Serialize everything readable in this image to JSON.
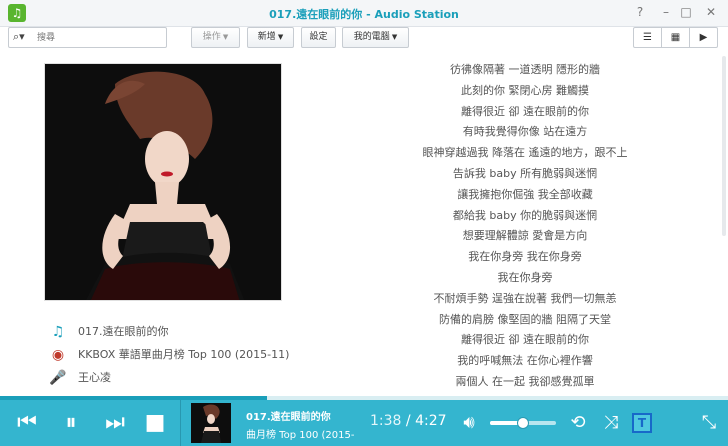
{
  "window": {
    "title_song": "017.遠在眼前的你",
    "title_sep": " - ",
    "title_app": "Audio Station",
    "buttons": {
      "help": "?",
      "minimize": "–",
      "maximize": "□",
      "close": "✕"
    }
  },
  "toolbar": {
    "search_placeholder": "搜尋",
    "action_label": "操作",
    "add_label": "新增",
    "settings_label": "設定",
    "my_computer_label": "我的電腦"
  },
  "song": {
    "title": "017.遠在眼前的你",
    "album": "KKBOX 華語單曲月榜 Top 100 (2015-11)",
    "artist": "王心凌"
  },
  "lyrics": [
    "彷彿像隔著 一道透明 隱形的牆",
    "此刻的你 緊閉心房 難觸摸",
    "離得很近 卻 遠在眼前的你",
    "有時我覺得你像 站在遠方",
    "眼神穿越過我 降落在 遙遠的地方，跟不上",
    "告訴我 baby 所有脆弱與迷惘",
    "讓我擁抱你倔強 我全部收藏",
    "都給我 baby 你的脆弱與迷惘",
    "想要理解體諒 愛會是方向",
    "我在你身旁 我在你身旁",
    "我在你身旁",
    "不耐煩手勢 逞強在說著 我們一切無恙",
    "防備的肩膀 像堅固的牆 阻隔了天堂",
    "離得很近 卻 遠在眼前的你",
    "我的呼喊無法 在你心裡作響",
    "兩個人 在一起 我卻感覺孤單"
  ],
  "player": {
    "now_playing_title": "017.遠在眼前的你",
    "now_playing_subtitle": "曲月榜 Top 100 (2015-",
    "current_time": "1:38",
    "time_sep": " / ",
    "total_time": "4:27",
    "progress": 0.367,
    "volume": 0.5,
    "lyric_toggle_label": "T"
  },
  "colors": {
    "accent": "#1a9fba",
    "player_bar": "#34b5cf",
    "progress": "#1a9fba"
  },
  "icons": {
    "app": "music-note-icon",
    "search": "search-icon",
    "list_view": "list-view-icon",
    "grid_view": "grid-view-icon",
    "now_playing_view": "play-view-icon",
    "song": "music-note-icon",
    "album": "disc-icon",
    "artist": "microphone-icon",
    "prev": "skip-previous-icon",
    "pause": "pause-icon",
    "next": "skip-next-icon",
    "stop": "stop-icon",
    "volume": "speaker-icon",
    "repeat": "repeat-icon",
    "shuffle": "shuffle-icon",
    "lyrics": "lyrics-icon",
    "fullscreen": "collapse-icon"
  }
}
